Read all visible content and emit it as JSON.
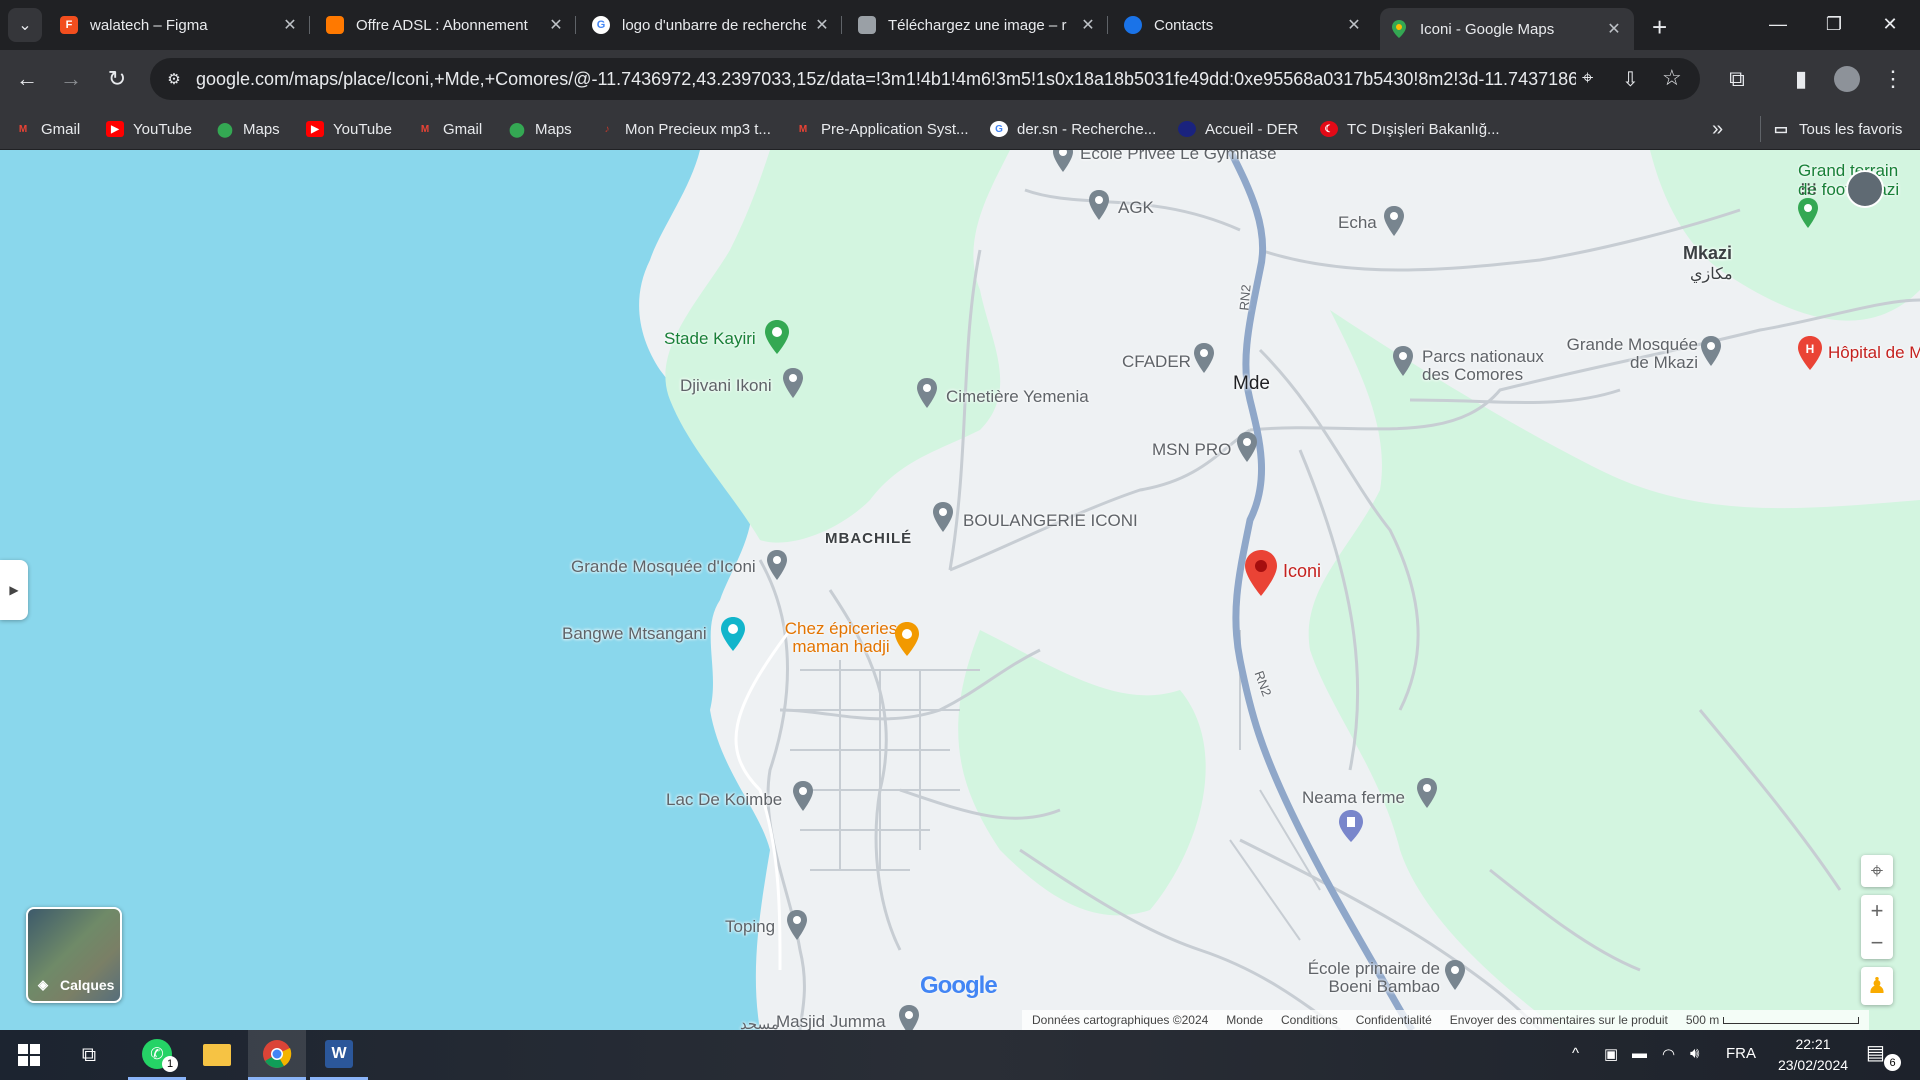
{
  "tabs": [
    {
      "title": "walatech – Figma",
      "favicon": "figma-icon",
      "color": "#f24e1e"
    },
    {
      "title": "Offre ADSL : Abonnement",
      "favicon": "orange-icon",
      "color": "#ff7900"
    },
    {
      "title": "logo d'unbarre de recherche",
      "favicon": "google-icon",
      "color": "#4285f4"
    },
    {
      "title": "Téléchargez une image – r",
      "favicon": "layers-icon",
      "color": "#9aa0a6"
    },
    {
      "title": "Contacts",
      "favicon": "contacts-icon",
      "color": "#1a73e8"
    },
    {
      "title": "Iconi - Google Maps",
      "favicon": "maps-icon",
      "color": "#34a853",
      "active": true
    }
  ],
  "toolbar": {
    "url": "google.com/maps/place/Iconi,+Mde,+Comores/@-11.7436972,43.2397033,15z/data=!3m1!4b1!4m6!3m5!1s0x18a18b5031fe49dd:0xe95568a0317b5430!8m2!3d-11.7437186!4d..."
  },
  "bookmarks": [
    {
      "label": "Gmail",
      "icon": "gmail-icon",
      "color": "#ea4335"
    },
    {
      "label": "YouTube",
      "icon": "youtube-icon",
      "color": "#ff0000"
    },
    {
      "label": "Maps",
      "icon": "maps-icon",
      "color": "#34a853"
    },
    {
      "label": "YouTube",
      "icon": "youtube-icon",
      "color": "#ff0000"
    },
    {
      "label": "Gmail",
      "icon": "gmail-icon",
      "color": "#ea4335"
    },
    {
      "label": "Maps",
      "icon": "maps-icon",
      "color": "#34a853"
    },
    {
      "label": "Mon Precieux mp3 t...",
      "icon": "music-icon",
      "color": "#c0392b"
    },
    {
      "label": "Pre-Application Syst...",
      "icon": "gmail-icon",
      "color": "#ea4335"
    },
    {
      "label": "der.sn - Recherche...",
      "icon": "google-icon",
      "color": "#4285f4"
    },
    {
      "label": "Accueil - DER",
      "icon": "der-icon",
      "color": "#1a237e"
    },
    {
      "label": "TC Dışişleri Bakanlığ...",
      "icon": "turkey-icon",
      "color": "#e30a17"
    }
  ],
  "all_bookmarks": "Tous les favoris",
  "map": {
    "places": {
      "ecole_privee": "Ecole Privée Le Gymnase",
      "agk": "AGK",
      "echa": "Echa",
      "mkazi": "Mkazi",
      "mkazi_ar": "مكازي",
      "grand_terrain": "Grand terrain de foot Mkazi",
      "stade_kayiri": "Stade Kayiri",
      "djivani": "Djivani Ikoni",
      "cimetiere": "Cimetière Yemenia",
      "cfader": "CFADER",
      "mde": "Mde",
      "parcs": "Parcs nationaux des Comores",
      "mosquee_mkazi": "Grande Mosquée de Mkazi",
      "hopital": "Hôpital de M",
      "msn_pro": "MSN PRO",
      "mbachile": "MBACHILÉ",
      "boulangerie": "BOULANGERIE ICONI",
      "iconi": "Iconi",
      "mosquee_iconi": "Grande Mosquée d'Iconi",
      "bangwe": "Bangwe Mtsangani",
      "chez_epiceries": "Chez épiceries maman hadji",
      "rn2": "RN2",
      "lac_koimbe": "Lac De Koimbe",
      "neama": "Neama ferme",
      "toping": "Toping",
      "ecole_boeni": "École primaire de Boeni Bambao",
      "masjid": "Masjid Jumma",
      "masjid_ar": "مسجد"
    },
    "layers_label": "Calques",
    "google_logo": "Google",
    "attribution": [
      "Données cartographiques ©2024",
      "Monde",
      "Conditions",
      "Confidentialité",
      "Envoyer des commentaires sur le produit"
    ],
    "scale": "500 m"
  },
  "taskbar": {
    "whatsapp_badge": "1",
    "language": "FRA",
    "time": "22:21",
    "date": "23/02/2024",
    "notifications": "6"
  }
}
